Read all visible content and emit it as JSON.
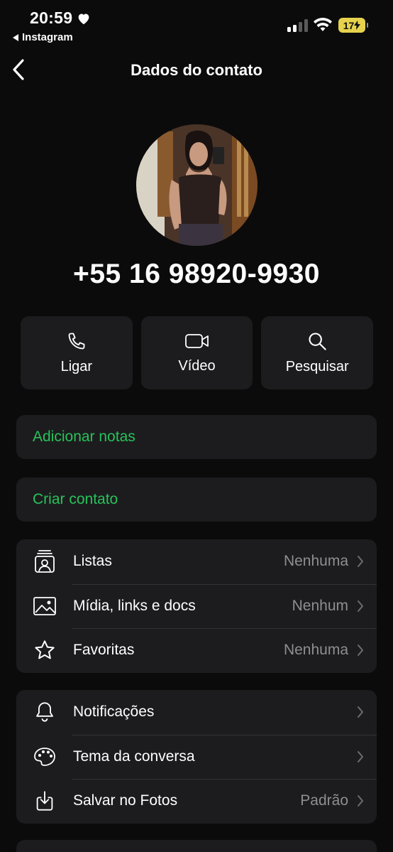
{
  "status_bar": {
    "time": "20:59",
    "back_app": "Instagram",
    "battery": "17"
  },
  "header": {
    "title": "Dados do contato"
  },
  "contact": {
    "phone": "+55 16 98920-9930"
  },
  "actions": [
    {
      "label": "Ligar",
      "icon": "phone-icon"
    },
    {
      "label": "Vídeo",
      "icon": "video-icon"
    },
    {
      "label": "Pesquisar",
      "icon": "search-icon"
    }
  ],
  "links": {
    "add_notes": "Adicionar notas",
    "create_contact": "Criar contato"
  },
  "group1": [
    {
      "label": "Listas",
      "value": "Nenhuma",
      "icon": "lists-icon"
    },
    {
      "label": "Mídia, links e docs",
      "value": "Nenhum",
      "icon": "image-icon"
    },
    {
      "label": "Favoritas",
      "value": "Nenhuma",
      "icon": "star-icon"
    }
  ],
  "group2": [
    {
      "label": "Notificações",
      "value": "",
      "icon": "bell-icon"
    },
    {
      "label": "Tema da conversa",
      "value": "",
      "icon": "palette-icon"
    },
    {
      "label": "Salvar no Fotos",
      "value": "Padrão",
      "icon": "save-download-icon"
    }
  ],
  "colors": {
    "accent_green": "#27c25b",
    "card_bg": "#1c1c1e",
    "secondary_text": "#8e8e93",
    "battery_yellow": "#e7d24d"
  }
}
